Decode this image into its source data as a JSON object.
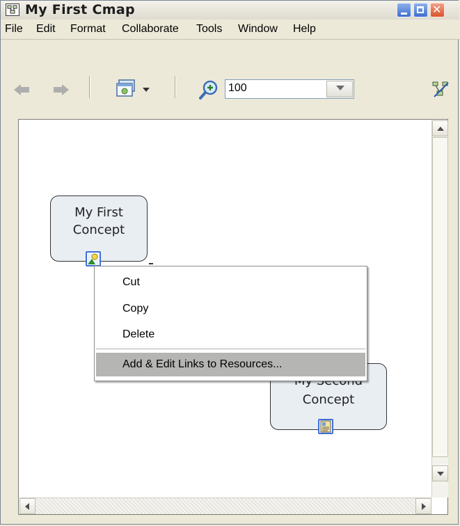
{
  "window": {
    "title": "My First Cmap"
  },
  "menubar": {
    "items": [
      "File",
      "Edit",
      "Format",
      "Collaborate",
      "Tools",
      "Window",
      "Help"
    ]
  },
  "toolbar": {
    "zoom_value": "100"
  },
  "concepts": [
    {
      "line1": "My First",
      "line2": "Concept"
    },
    {
      "line1": "My Second",
      "line2": "Concept"
    }
  ],
  "context_menu": {
    "items": [
      "Cut",
      "Copy",
      "Delete",
      "Add & Edit Links to Resources..."
    ],
    "highlighted_item": "Add & Edit Links to Resources..."
  },
  "colors": {
    "window_bg": "#ece9d8",
    "concept_fill": "#e9eef3",
    "menu_highlight": "#b5b5b3",
    "title_close_button": "#d9532c",
    "title_min_max_buttons": "#3d6ed0"
  },
  "icons": [
    "app-cmap-icon",
    "minimize-icon",
    "maximize-icon",
    "close-icon",
    "back-arrow-icon",
    "forward-arrow-icon",
    "view-options-icon",
    "zoom-in-icon",
    "collaborate-icon",
    "resource-image-icon",
    "resource-document-icon"
  ]
}
